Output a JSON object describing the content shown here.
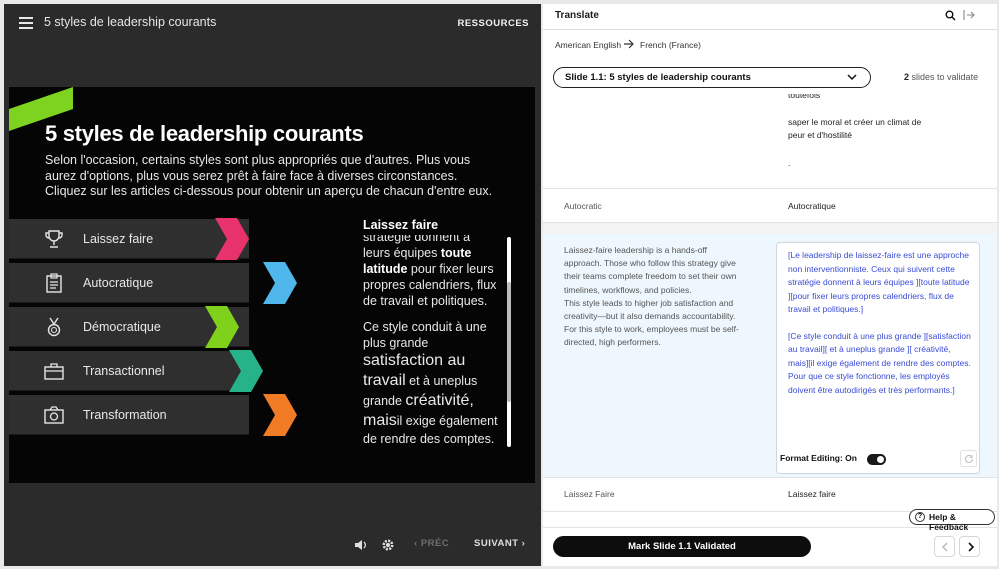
{
  "player": {
    "course_title": "5 styles de leadership courants",
    "resources_label": "RESSOURCES",
    "slide": {
      "title": "5 styles de leadership courants",
      "intro": "Selon l'occasion, certains styles sont plus appropriés que d'autres. Plus vous aurez d'options, plus vous serez prêt à faire face à diverses circonstances. Cliquez sur les articles ci-dessous pour obtenir un aperçu de chacun d'entre eux.",
      "menu": [
        {
          "label": "Laissez faire",
          "icon": "trophy-icon",
          "color": "#e8326b"
        },
        {
          "label": "Autocratique",
          "icon": "clipboard-icon",
          "color": "#4fb7ec"
        },
        {
          "label": "Démocratique",
          "icon": "medal-icon",
          "color": "#7fd11b"
        },
        {
          "label": "Transactionnel",
          "icon": "briefcase-icon",
          "color": "#27b389"
        },
        {
          "label": "Transformation",
          "icon": "camera-icon",
          "color": "#f27b26"
        }
      ],
      "detail": {
        "title": "Laissez faire",
        "line_cut": "stratégie donnent à",
        "p1_a": "leurs équipes ",
        "p1_b": "toute latitude",
        "p1_c": " pour fixer leurs propres calendriers, flux de travail et politiques.",
        "p2_a": "Ce style conduit à une plus grande",
        "p2_b": "satisfaction au travail",
        "p2_c": " et à uneplus grande ",
        "p2_d": "créativité, mais",
        "p2_e": "il exige également de rendre des comptes."
      }
    },
    "bottom": {
      "prev_label": "PRÉC",
      "next_label": "SUIVANT"
    }
  },
  "translate": {
    "title": "Translate",
    "source_lang": "American English",
    "target_lang": "French (France)",
    "slide_select": "Slide 1.1: 5 styles de leadership courants",
    "validate_count": "2",
    "validate_suffix": "slides to validate",
    "rows": [
      {
        "source": "",
        "target_lines": [
          "toutefois",
          "",
          "saper le moral et créer un climat de peur et d'hostilité",
          "",
          "."
        ]
      },
      {
        "source": "Autocratic",
        "target": "Autocratique"
      },
      {
        "source": "Laissez-faire leadership is a hands-off approach. Those who follow this strategy give their teams complete freedom to set their own timelines, workflows, and policies.",
        "source2": "This style leads to higher job satisfaction and creativity—but it also demands accountability. For this style to work, employees must be self-directed, high performers.",
        "edit_p1": "[Le leadership de laissez-faire est une approche non interventionniste. Ceux qui suivent cette stratégie donnent à leurs équipes ][toute latitude ][pour fixer leurs propres calendriers, flux de travail et politiques.]",
        "edit_p2": "[Ce style conduit à une plus grande ][satisfaction au travail][ et à uneplus grande ][ créativité, mais][il exige également de rendre des comptes. Pour que ce style fonctionne, les employés doivent être autodirigés et très performants.]",
        "format_label": "Format Editing: On"
      },
      {
        "source": "Laissez Faire",
        "target": "Laissez faire"
      }
    ],
    "help_label": "Help & Feedback",
    "mark_label": "Mark Slide 1.1 Validated"
  },
  "colors": {
    "accent_green": "#7ed321",
    "edit_blue": "#3a4bd6",
    "panel_highlight": "#eef7fd"
  }
}
